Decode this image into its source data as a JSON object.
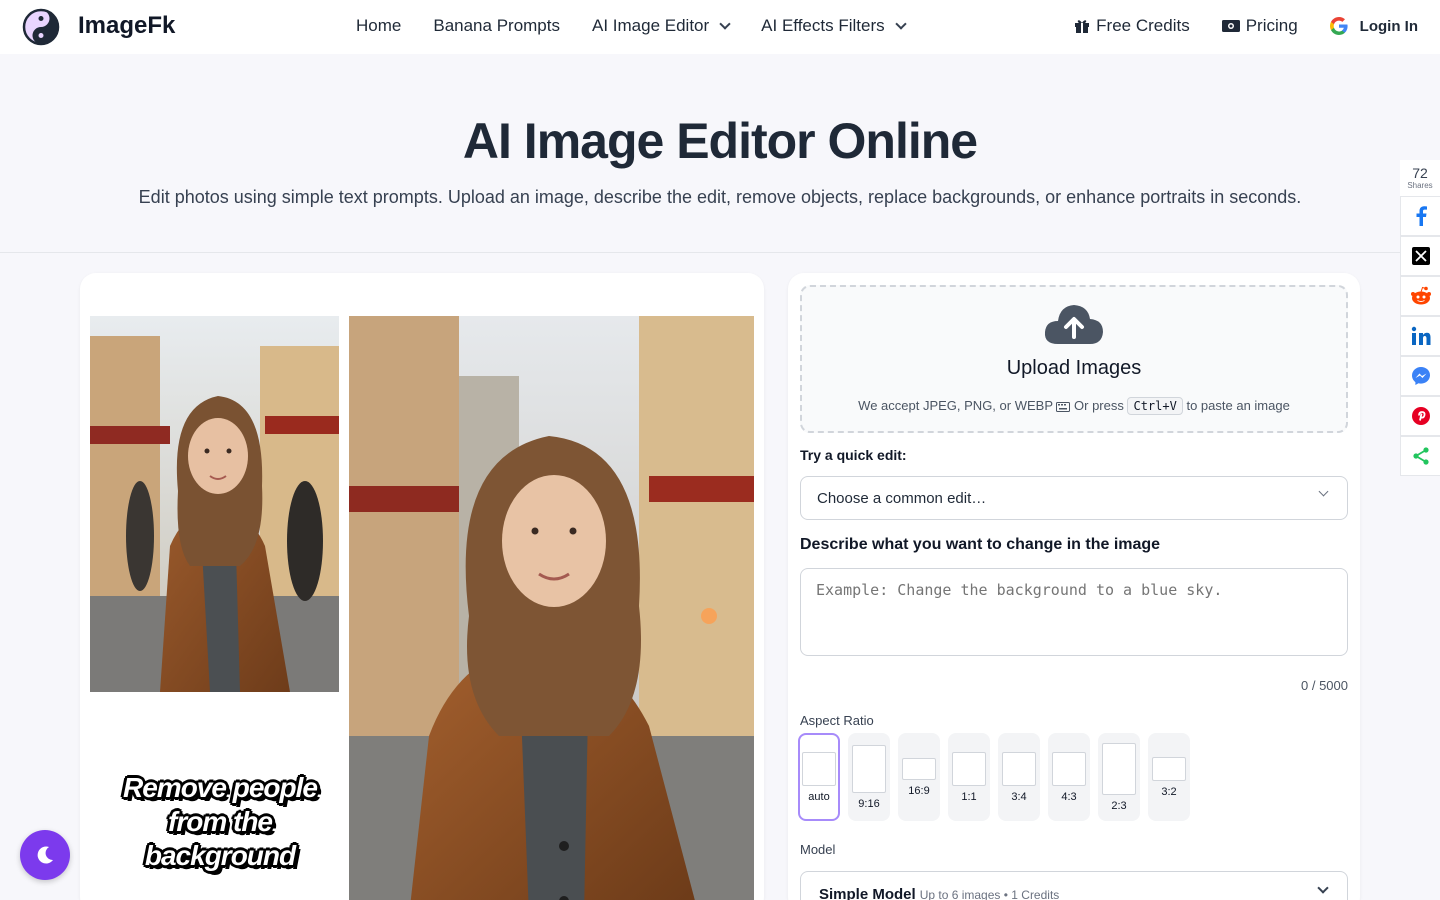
{
  "nav": {
    "brand": "ImageFk",
    "links": [
      {
        "label": "Home"
      },
      {
        "label": "Banana Prompts"
      },
      {
        "label": "AI Image Editor"
      },
      {
        "label": "AI Effects Filters"
      }
    ],
    "free_credits": "Free Credits",
    "pricing": "Pricing",
    "login": "Login In"
  },
  "hero": {
    "title": "AI Image Editor Online",
    "subtitle": "Edit photos using simple text prompts. Upload an image, describe the edit, remove objects, replace backgrounds, or enhance portraits in seconds."
  },
  "example": {
    "overlay_line1": "Remove people",
    "overlay_line2": "from the background"
  },
  "upload": {
    "title": "Upload Images",
    "sub_prefix": "We accept JPEG, PNG, or WEBP",
    "sub_or": "Or press",
    "shortcut": "Ctrl+V",
    "sub_suffix": "to paste an image"
  },
  "quick_edit": {
    "label": "Try a quick edit:",
    "placeholder": "Choose a common edit…"
  },
  "prompt": {
    "label": "Describe what you want to change in the image",
    "placeholder": "Example: Change the background to a blue sky.",
    "counter": "0 / 5000"
  },
  "aspect": {
    "label": "Aspect Ratio",
    "options": [
      "auto",
      "9:16",
      "16:9",
      "1:1",
      "3:4",
      "4:3",
      "2:3",
      "3:2"
    ],
    "selected": "auto"
  },
  "model": {
    "label": "Model",
    "name": "Simple Model",
    "detail": "Up to 6 images • 1 Credits"
  },
  "share": {
    "count": "72",
    "label": "Shares"
  },
  "colors": {
    "accent": "#7c3aed",
    "facebook": "#1877f2",
    "reddit": "#ff4500",
    "linkedin": "#0a66c2",
    "messenger": "#3b82f6",
    "pinterest": "#e60023",
    "share": "#22c55e"
  }
}
